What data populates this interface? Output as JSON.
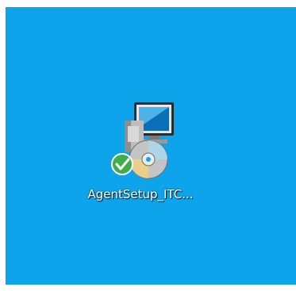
{
  "desktop": {
    "background_color": "#0ea4ec",
    "icons": [
      {
        "label": "AgentSetup_ITC...",
        "icon": "installer-package-icon",
        "badge": "verified-check-icon"
      }
    ]
  }
}
